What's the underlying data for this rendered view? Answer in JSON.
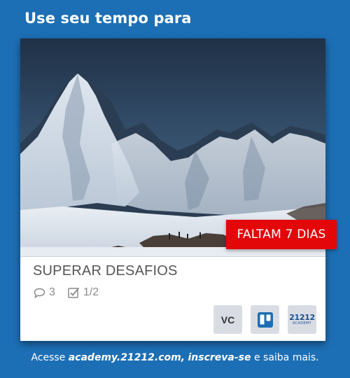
{
  "headline": "Use seu tempo para",
  "card": {
    "photo_icon": "snowy-mountain-photo",
    "badge": "FALTAM 7 DIAS",
    "title": "SUPERAR DESAFIOS",
    "comments": {
      "icon": "comment-icon",
      "count": "3"
    },
    "checklist": {
      "icon": "checklist-icon",
      "progress": "1/2"
    },
    "members": [
      {
        "type": "initials",
        "label": "VC"
      },
      {
        "type": "icon",
        "icon": "trello-icon"
      },
      {
        "type": "logo",
        "number": "21212",
        "word": "ACADEMY"
      }
    ]
  },
  "footer": {
    "prefix": "Acesse ",
    "link": "academy.21212.com,",
    "space": " ",
    "action": "inscreva-se",
    "suffix": " e saiba mais."
  },
  "colors": {
    "background": "#1d6fb5",
    "badge": "#e3070a",
    "title_text": "#555555"
  }
}
